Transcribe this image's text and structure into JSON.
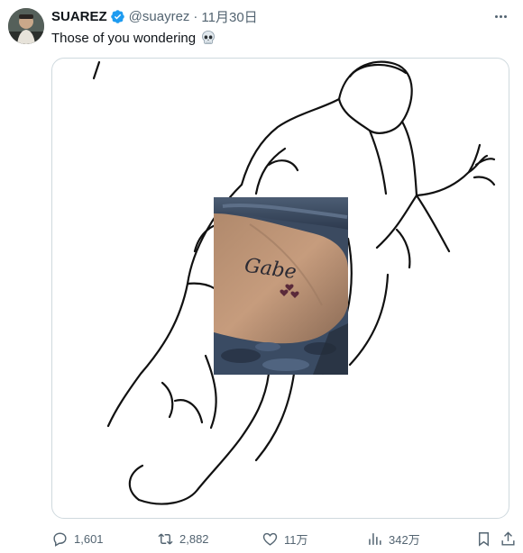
{
  "tweet": {
    "author_name": "SUAREZ",
    "handle": "@suayrez",
    "separator": "·",
    "date": "11月30日",
    "text": "Those of you wondering",
    "emoji": "skull-emoji",
    "verified_color": "#1d9bf0"
  },
  "image_caption": {
    "tattoo_text": "Gabe"
  },
  "actions": {
    "replies": "1,601",
    "retweets": "2,882",
    "likes": "11万",
    "views": "342万"
  },
  "icons": [
    "more-icon",
    "verified-icon",
    "reply-icon",
    "retweet-icon",
    "like-icon",
    "views-icon",
    "bookmark-icon",
    "share-icon"
  ],
  "colors": {
    "text_primary": "#0f1419",
    "text_secondary": "#536471",
    "border": "#cfd9de"
  }
}
